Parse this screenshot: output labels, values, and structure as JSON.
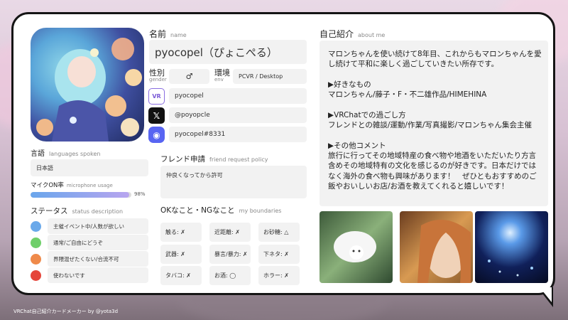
{
  "profile": {
    "name_label": "名前",
    "name_sub": "name",
    "name_value": "pyocopel（ぴょこぺる）",
    "gender_label": "性別",
    "gender_sub": "gender",
    "gender_value": "♂",
    "env_label": "環境",
    "env_sub": "env",
    "env_value": "PCVR / Desktop"
  },
  "accounts": [
    {
      "service": "VRChat",
      "icon": "vrchat-icon",
      "icon_text": "VR",
      "value": "pyocopel"
    },
    {
      "service": "X",
      "icon": "x-icon",
      "icon_text": "𝕏",
      "value": "@poyopcle"
    },
    {
      "service": "Discord",
      "icon": "discord-icon",
      "icon_text": "◉",
      "value": "pyocopel#8331"
    }
  ],
  "languages": {
    "label": "言語",
    "sub": "languages spoken",
    "value": "日本語"
  },
  "mic": {
    "label": "マイクON率",
    "sub": "microphone usage",
    "percent_text": "98%",
    "percent": 98
  },
  "status": {
    "label": "ステータス",
    "sub": "status description",
    "items": [
      {
        "color": "#6aa9ea",
        "text": "主催イベント中/人数が欲しい"
      },
      {
        "color": "#6fcf6a",
        "text": "通常/ご自由にどうぞ"
      },
      {
        "color": "#ef8a4a",
        "text": "界隈混ぜたくない/合流不可"
      },
      {
        "color": "#e5453a",
        "text": "使わないです"
      }
    ]
  },
  "friend": {
    "label": "フレンド申請",
    "sub": "friend request policy",
    "value": "仲良くなってから許可"
  },
  "boundaries": {
    "label": "OKなこと・NGなこと",
    "sub": "my boundaries",
    "items": [
      "触る: ✗",
      "近距離: ✗",
      "お砂糖: △",
      "武器: ✗",
      "暴言/暴力: ✗",
      "下ネタ: ✗",
      "タバコ: ✗",
      "お酒: ◯",
      "ホラー: ✗"
    ]
  },
  "about": {
    "label": "自己紹介",
    "sub": "about me",
    "text": "マロンちゃんを使い続けて8年目、これからもマロンちゃんを愛し続けて平和に楽しく過ごしていきたい所存です。\n\n▶好きなもの\nマロンちゃん/藤子・F・不二雄作品/HIMEHINA\n\n▶VRChatでの過ごし方\nフレンドとの雑談/運動/作業/写真撮影/マロンちゃん集会主催\n\n▶その他コメント\n旅行に行ってその地域特産の食べ物や地酒をいただいたり方言含めその地域特有の文化を感じるのが好きです。日本だけではなく海外の食べ物も興味があります！　ぜひともおすすめのご飯やおいしいお店/お酒を教えてくれると嬉しいです！"
  },
  "footer": "VRChat自己紹介カードメーカー by @yota3d"
}
